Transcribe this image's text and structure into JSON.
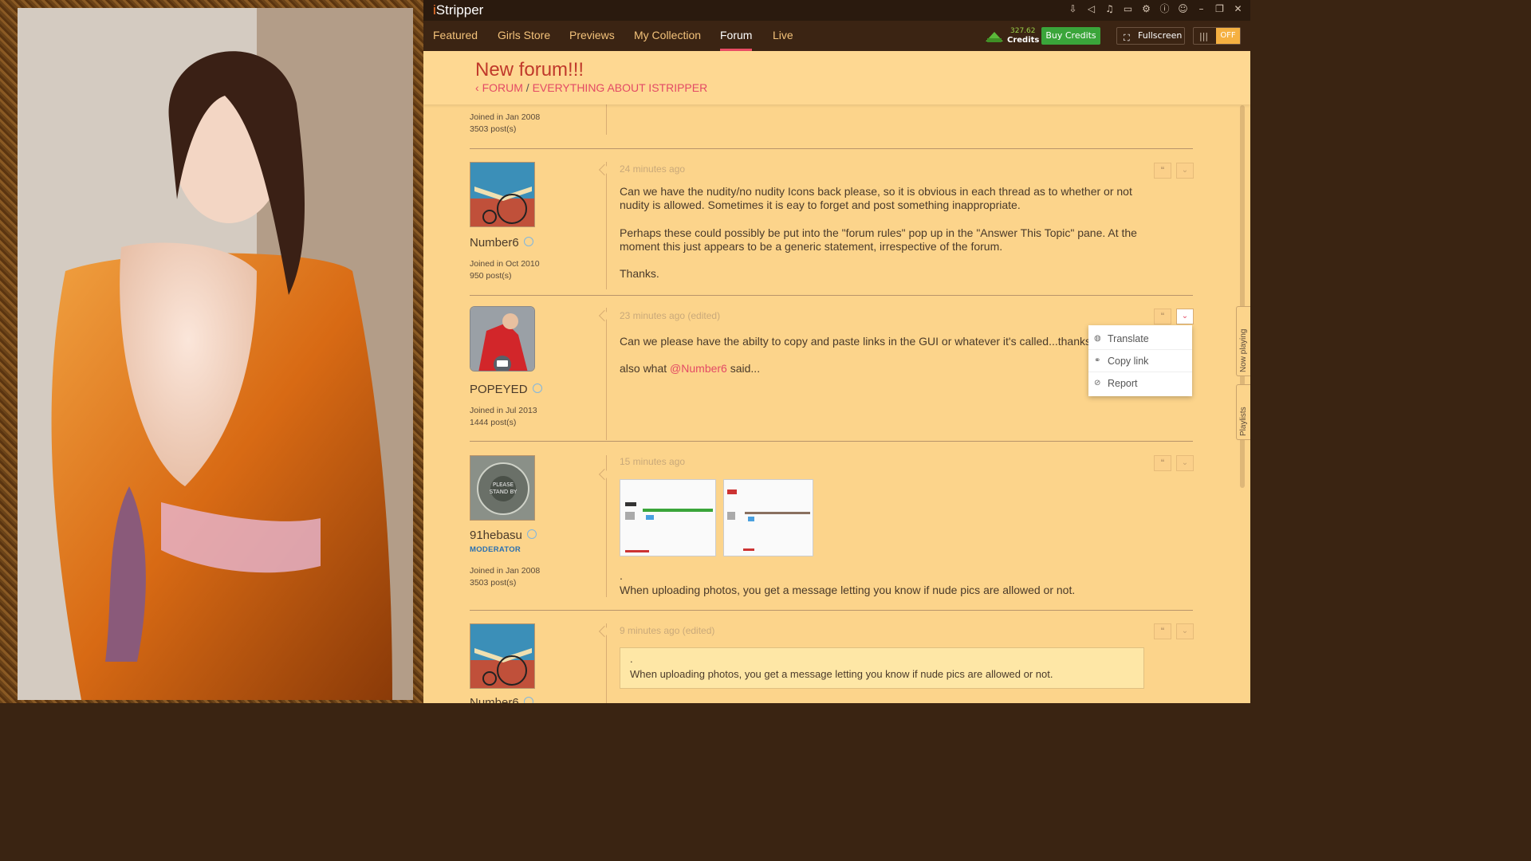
{
  "app": {
    "logo_i": "i",
    "logo_rest": "Stripper"
  },
  "window_icons": [
    "download-icon",
    "announce-icon",
    "music-icon",
    "monitor-icon",
    "gear-icon",
    "info-icon",
    "user-icon",
    "minimize-icon",
    "restore-icon",
    "close-icon"
  ],
  "nav": {
    "items": [
      "Featured",
      "Girls Store",
      "Previews",
      "My Collection",
      "Forum",
      "Live"
    ],
    "active": "Forum",
    "credits_value": "327.62",
    "credits_label": "Credits",
    "buy_label": "Buy Credits",
    "fullscreen_label": "Fullscreen",
    "toggle_state": "OFF"
  },
  "forum": {
    "title": "New forum!!!",
    "breadcrumb_root": "FORUM",
    "breadcrumb_sep": "/",
    "breadcrumb_leaf": "EVERYTHING ABOUT ISTRIPPER"
  },
  "posts": [
    {
      "joined": "Joined in Jan 2008",
      "posts": "3503 post(s)"
    },
    {
      "username": "Number6",
      "joined": "Joined in Oct 2010",
      "posts": "950 post(s)",
      "time": "24 minutes ago",
      "p1_l1": "Can we have the nudity/no nudity Icons back please, so it is obvious in each thread as to whether or not",
      "p1_l2": "nudity is allowed. Sometimes it is eay to forget and post something inappropriate.",
      "p2_l1": "Perhaps these could possibly be put into the \"forum rules\" pop up in the \"Answer This Topic\" pane. At the",
      "p2_l2": "moment this just appears to be a generic statement, irrespective of the forum.",
      "p3": "Thanks."
    },
    {
      "username": "POPEYED",
      "joined": "Joined in Jul 2013",
      "posts": "1444 post(s)",
      "time": "23 minutes ago (edited)",
      "p1": "Can we please have the abilty to copy and paste links in the GUI or whatever it's called...thanks!",
      "p2_pre": "also what ",
      "p2_mention": "@Number6",
      "p2_post": " said..."
    },
    {
      "username": "91hebasu",
      "role": "MODERATOR",
      "joined": "Joined in Jan 2008",
      "posts": "3503 post(s)",
      "time": "15 minutes ago",
      "dot": ".",
      "text": "When uploading photos, you get a message letting you know if nude pics are allowed or not."
    },
    {
      "username": "Number6",
      "time": "9 minutes ago (edited)",
      "quote_dot": ".",
      "quote_text": "When uploading photos, you get a message letting you know if nude pics are allowed or not."
    }
  ],
  "dropdown": {
    "items": [
      "Translate",
      "Copy link",
      "Report"
    ]
  },
  "side_tabs": {
    "now_playing": "Now playing",
    "playlists": "Playlists"
  },
  "colors": {
    "accent": "#e94c64",
    "content_bg": "#fcd48b",
    "nav_bg": "#3b2413",
    "buy_green": "#3aa53a",
    "toggle_off": "#f5b041"
  }
}
